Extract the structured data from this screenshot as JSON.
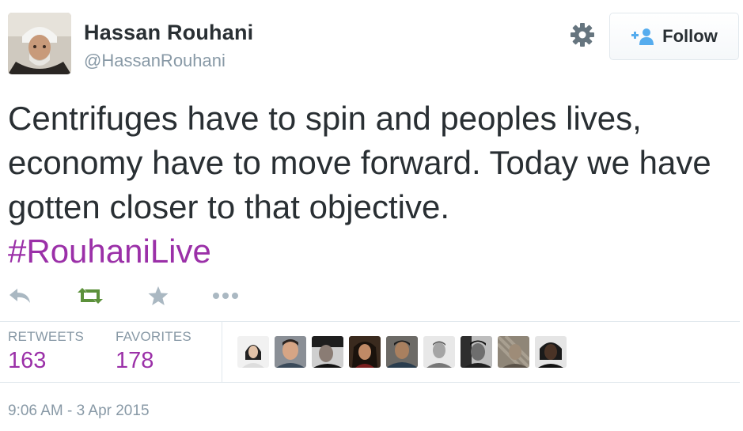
{
  "user": {
    "name": "Hassan Rouhani",
    "handle": "@HassanRouhani"
  },
  "follow_button": {
    "label": "Follow",
    "icon": "add-user-icon"
  },
  "settings_icon": "gear-icon",
  "tweet": {
    "text": "Centrifuges have to spin and peoples lives, economy have to move forward. Today we have gotten closer to that objective.",
    "hashtag": "#RouhaniLive"
  },
  "actions": [
    {
      "name": "reply",
      "icon": "reply-icon"
    },
    {
      "name": "retweet",
      "icon": "retweet-icon",
      "color": "#5c913b"
    },
    {
      "name": "favorite",
      "icon": "star-icon"
    },
    {
      "name": "more",
      "icon": "more-icon"
    }
  ],
  "stats": {
    "retweets_label": "RETWEETS",
    "retweets_count": "163",
    "favorites_label": "FAVORITES",
    "favorites_count": "178"
  },
  "timestamp": "9:06 AM - 3 Apr 2015",
  "colors": {
    "hashtag": "#9b30a8",
    "muted": "#8899a6",
    "text": "#292f33",
    "link_blue": "#55acee"
  }
}
